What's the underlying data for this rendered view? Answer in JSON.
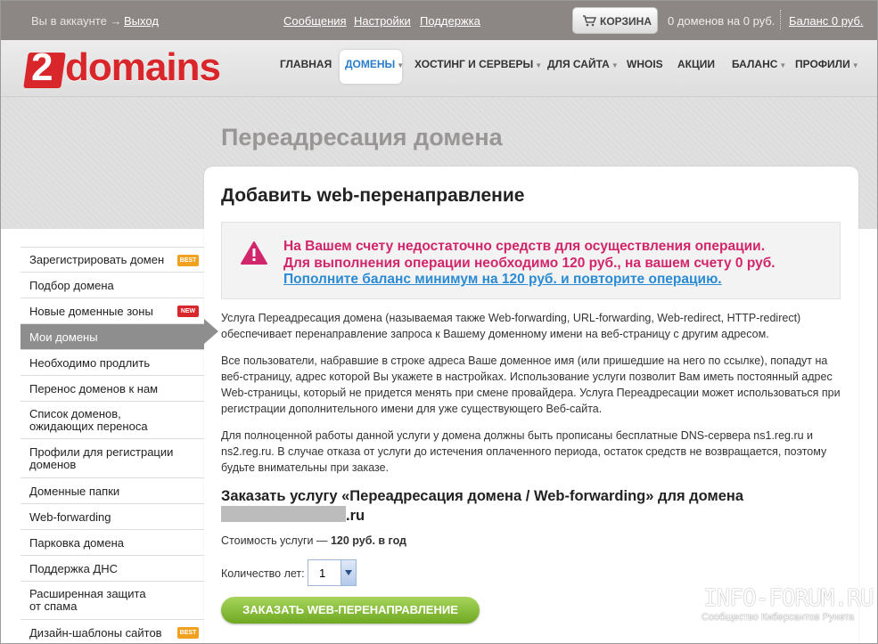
{
  "topbar": {
    "account_text": "Вы в аккаунте →",
    "logout": "Выход",
    "links": [
      "Сообщения",
      "Настройки",
      "Поддержка"
    ],
    "cart_label": "КОРЗИНА",
    "cart_status": "0 доменов на 0 руб.",
    "balance": "Баланс 0 руб."
  },
  "logo": {
    "digit": "2",
    "name": "domains"
  },
  "nav": [
    {
      "label": "ГЛАВНАЯ",
      "dropdown": false
    },
    {
      "label": "ДОМЕНЫ",
      "dropdown": true,
      "active": true
    },
    {
      "label": "ХОСТИНГ И СЕРВЕРЫ",
      "dropdown": true
    },
    {
      "label": "ДЛЯ САЙТА",
      "dropdown": true
    },
    {
      "label": "WHOIS",
      "dropdown": false
    },
    {
      "label": "АКЦИИ",
      "dropdown": false
    },
    {
      "label": "БАЛАНС",
      "dropdown": true
    },
    {
      "label": "ПРОФИЛИ",
      "dropdown": true
    }
  ],
  "page_title": "Переадресация домена",
  "sidebar": [
    {
      "label": "Зарегистрировать домен",
      "badge": "BEST"
    },
    {
      "label": "Подбор домена"
    },
    {
      "label": "Новые доменные зоны",
      "badge": "NEW"
    },
    {
      "label": "Мои домены",
      "active": true
    },
    {
      "label": "Необходимо продлить"
    },
    {
      "label": "Перенос доменов к нам"
    },
    {
      "label": "Список доменов, ожидающих переноса"
    },
    {
      "label": "Профили для регистрации доменов"
    },
    {
      "label": "Доменные папки"
    },
    {
      "label": "Web-forwarding"
    },
    {
      "label": "Парковка домена"
    },
    {
      "label": "Поддержка ДНС"
    },
    {
      "label": "Расширенная защита от спама"
    },
    {
      "label": "Дизайн-шаблоны сайтов",
      "badge": "BEST"
    }
  ],
  "card_title": "Добавить web-перенаправление",
  "alert": {
    "line1": "На Вашем счету недостаточно средств для осуществления операции.",
    "line2": "Для выполнения операции необходимо 120 руб., на вашем счету 0 руб.",
    "link": "Пополните баланс минимум на 120 руб. и повторите операцию."
  },
  "paragraphs": [
    "Услуга Переадресация домена (называемая также Web-forwarding, URL-forwarding, Web-redirect, HTTP-redirect) обеспечивает перенаправление запроса к Вашему доменному имени на веб-страницу с другим адресом.",
    "Все пользователи, набравшие в строке адреса Ваше доменное имя (или пришедшие на него по ссылке), попадут на веб-страницу, адрес которой Вы укажете в настройках. Использование услуги позволит Вам иметь постоянный адрес Web-страницы, который не придется менять при смене провайдера. Услуга Переадресации может использоваться при регистрации дополнительного имени для уже существующего Веб-сайта.",
    "Для полноценной работы данной услуги у домена должны быть прописаны бесплатные DNS-сервера ns1.reg.ru и ns2.reg.ru. В случае отказа от услуги до истечения оплаченного периода, остаток средств не возвращается, поэтому будьте внимательны при заказе."
  ],
  "order": {
    "heading": "Заказать услугу «Переадресация домена / Web-forwarding» для домена",
    "domain_suffix": ".ru",
    "price_label": "Стоимость услуги —",
    "price_value": "120 руб. в год",
    "years_label": "Количество лет:",
    "years_value": "1",
    "button": "ЗАКАЗАТЬ WEB-ПЕРЕНАПРАВЛЕНИЕ"
  },
  "watermark": {
    "title": "INFO-FORUM.RU",
    "subtitle": "Сообщество Киберсантов Рунета"
  },
  "colors": {
    "alert_text": "#d1266b",
    "link": "#2a8bd3",
    "brand": "#d9262b",
    "button": "#7db32d"
  }
}
